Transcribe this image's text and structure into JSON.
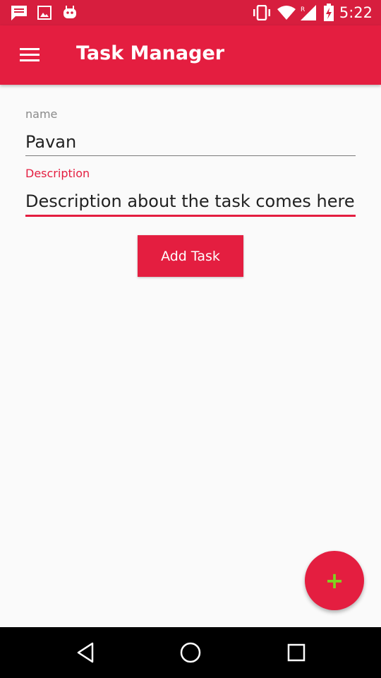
{
  "status_bar": {
    "time": "5:22",
    "icons": [
      "message-icon",
      "image-icon",
      "android-icon",
      "vibrate-icon",
      "wifi-icon",
      "signal-icon",
      "battery-charging-icon"
    ]
  },
  "app_bar": {
    "title": "Task Manager",
    "menu_icon": "hamburger-menu-icon"
  },
  "form": {
    "name_label": "name",
    "name_value": "Pavan",
    "description_label": "Description",
    "description_value": "Description about the task comes here",
    "add_button_label": "Add Task"
  },
  "fab": {
    "symbol": "+"
  },
  "navigation": [
    "back-icon",
    "home-icon",
    "recents-icon"
  ],
  "colors": {
    "primary": "#e41e40",
    "primary_dark": "#d71e3e",
    "accent": "#7fd320",
    "background": "#fafafa"
  }
}
